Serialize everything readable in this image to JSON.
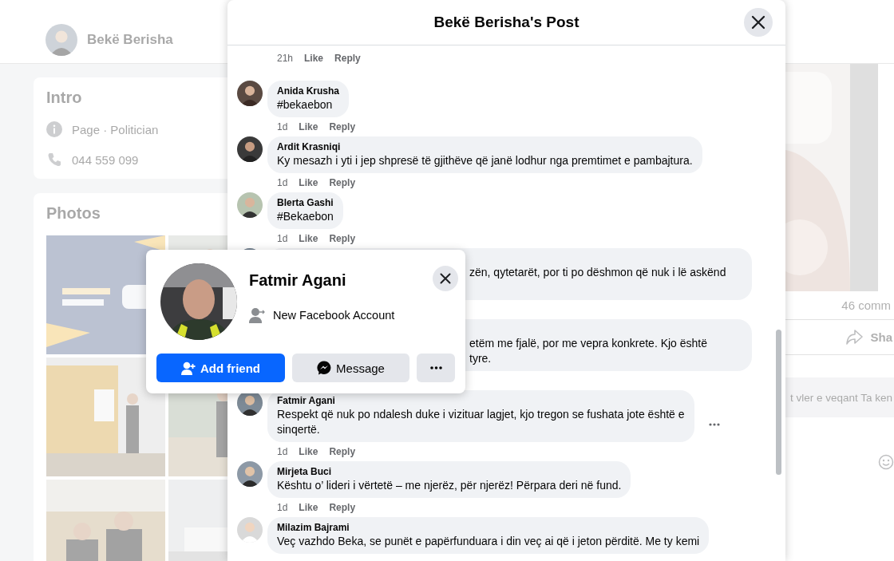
{
  "page": {
    "profile_name": "Bekë Berisha",
    "intro": {
      "title": "Intro",
      "items": [
        {
          "kind": "info",
          "text": "Page · Politician"
        },
        {
          "kind": "phone",
          "text": "044 559 099"
        }
      ]
    },
    "photos": {
      "title": "Photos"
    },
    "post": {
      "comment_count": "46 comm",
      "share_label": "Sha",
      "comment_preview": "t vler e veqant Ta ken"
    }
  },
  "dialog": {
    "title": "Bekë Berisha's Post",
    "comments": [
      {
        "time": "21h",
        "like": "Like",
        "reply": "Reply",
        "hovered": false
      },
      {
        "author": "Anida Krusha",
        "lines": [
          "#bekaebon"
        ],
        "time": "1d",
        "like": "Like",
        "reply": "Reply",
        "covered": false,
        "avatar_covered": false,
        "hovered": false
      },
      {
        "author": "Ardit Krasniqi",
        "lines": [
          "Ky mesazh i yti i jep shpresë të gjithëve që janë lodhur nga premtimet e pambajtura."
        ],
        "time": "1d",
        "like": "Like",
        "reply": "Reply",
        "covered": false,
        "avatar_covered": false,
        "hovered": false
      },
      {
        "author": "Blerta Gashi",
        "lines": [
          "#Bekaebon"
        ],
        "time": "1d",
        "like": "Like",
        "reply": "Reply",
        "covered": false,
        "avatar_covered": false,
        "hovered": false
      },
      {
        "lines": [
          "zën, qytetarët, por ti po dëshmon që nuk i lë askënd"
        ],
        "covered": true,
        "avatar_covered": false,
        "hovered": false
      },
      {
        "lines": [
          "etëm me fjalë, por me vepra konkrete. Kjo është",
          "tyre."
        ],
        "covered": true,
        "avatar_covered": true,
        "hovered": false
      },
      {
        "author": "Fatmir Agani",
        "lines": [
          "Respekt që nuk po ndalesh duke i vizituar lagjet, kjo tregon se fushata jote është e",
          "sinqertë."
        ],
        "time": "1d",
        "like": "Like",
        "reply": "Reply",
        "covered": false,
        "avatar_covered": false,
        "hovered": true
      },
      {
        "author": "Mirjeta Buci",
        "lines": [
          "Kështu o’ lideri i vërtetë – me njerëz, për njerëz! Përpara deri në fund."
        ],
        "time": "1d",
        "like": "Like",
        "reply": "Reply",
        "covered": false,
        "avatar_covered": false,
        "hovered": false
      },
      {
        "author": "Milazim Bajrami",
        "lines": [
          "Veç vazhdo Beka, se punët e papërfunduara i din veç ai që i jeton përditë. Me ty kemi"
        ],
        "covered": false,
        "avatar_covered": false,
        "hovered": false
      }
    ]
  },
  "profile_card": {
    "name": "Fatmir Agani",
    "detail": "New Facebook Account",
    "buttons": [
      {
        "kind": "add_friend",
        "label": "Add friend"
      },
      {
        "kind": "message",
        "label": "Message"
      },
      {
        "kind": "more"
      }
    ]
  }
}
